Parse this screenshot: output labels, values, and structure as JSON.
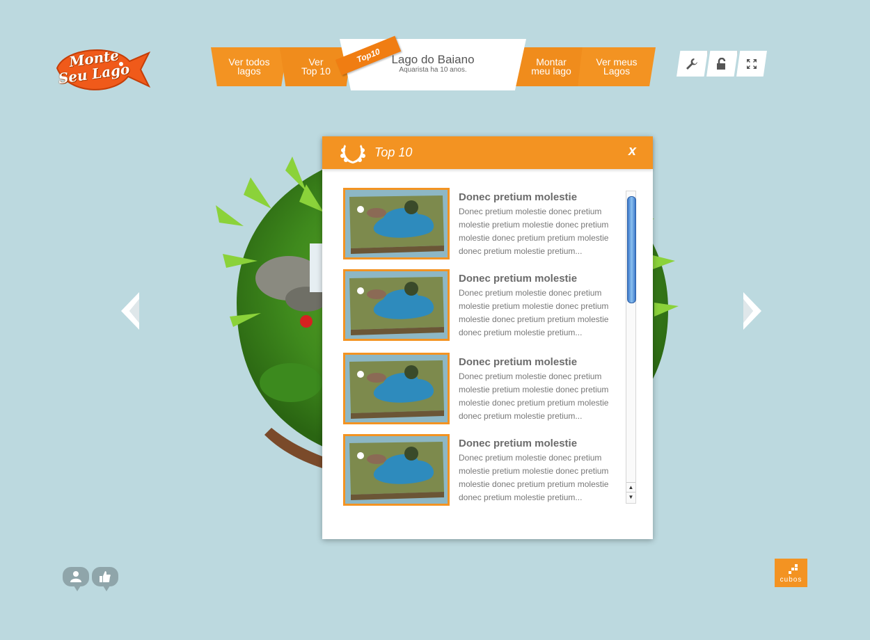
{
  "logo": {
    "line1": "Monte",
    "line2": "Seu Lago"
  },
  "nav": {
    "all_lakes": [
      "Ver todos",
      "lagos"
    ],
    "top10": [
      "Ver",
      "Top 10"
    ],
    "center_title": "Lago do Baiano",
    "center_subtitle": "Aquarista ha 10 anos.",
    "ribbon": "Top10",
    "build_lake": [
      "Montar",
      "meu lago"
    ],
    "my_lakes": [
      "Ver meus",
      "Lagos"
    ]
  },
  "tools": [
    "wrench-icon",
    "unlock-icon",
    "fullscreen-icon"
  ],
  "modal": {
    "title": "Top 10",
    "close": "x",
    "items": [
      {
        "title": "Donec pretium molestie",
        "desc": "Donec pretium molestie donec pretium molestie pretium molestie donec pretium molestie donec pretium pretium molestie donec pretium molestie pretium..."
      },
      {
        "title": "Donec pretium molestie",
        "desc": "Donec pretium molestie donec pretium molestie pretium molestie donec pretium molestie donec pretium pretium molestie donec pretium molestie pretium..."
      },
      {
        "title": "Donec pretium molestie",
        "desc": "Donec pretium molestie donec pretium molestie pretium molestie donec pretium molestie donec pretium pretium molestie donec pretium molestie pretium..."
      },
      {
        "title": "Donec pretium molestie",
        "desc": "Donec pretium molestie donec pretium molestie pretium molestie donec pretium molestie donec pretium pretium molestie donec pretium molestie pretium..."
      }
    ]
  },
  "brand": {
    "label": "cubos"
  },
  "colors": {
    "background": "#bcd9df",
    "accent": "#f39322"
  }
}
